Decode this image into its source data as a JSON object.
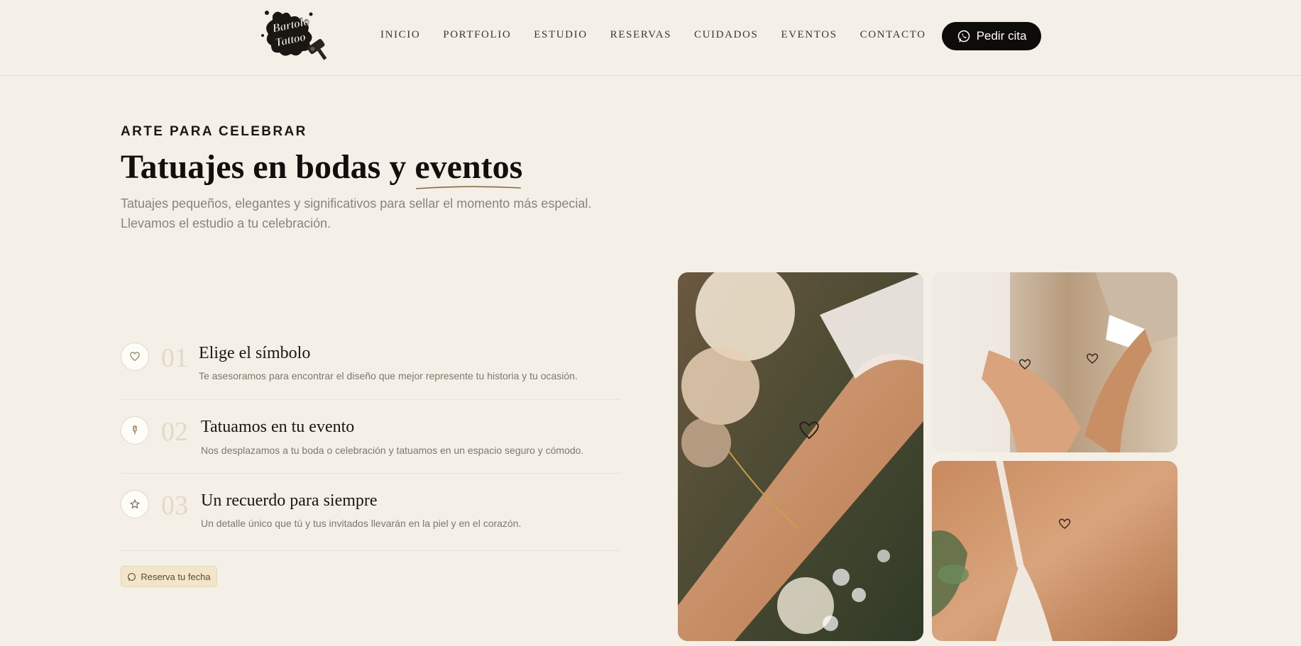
{
  "header": {
    "logo_text": "Bartolo Tattoo",
    "nav": [
      {
        "label": "INICIO"
      },
      {
        "label": "PORTFOLIO"
      },
      {
        "label": "ESTUDIO"
      },
      {
        "label": "RESERVAS"
      },
      {
        "label": "CUIDADOS"
      },
      {
        "label": "EVENTOS"
      },
      {
        "label": "CONTACTO"
      }
    ],
    "cta_label": "Pedir cita",
    "cta_icon": "whatsapp-icon"
  },
  "hero": {
    "eyebrow": "ARTE PARA CELEBRAR",
    "title_start": "Tatuajes en bodas y ",
    "title_emphasis": "eventos",
    "subtitle_line1": "Tatuajes pequeños, elegantes y significativos para sellar el momento más especial.",
    "subtitle_line2": "Llevamos el estudio a tu celebración."
  },
  "steps": [
    {
      "icon": "heart-icon",
      "number": "01",
      "title": "Elige el símbolo",
      "description": "Te asesoramos para encontrar el diseño que mejor represente tu historia y tu ocasión."
    },
    {
      "icon": "tattoo-machine-icon",
      "number": "02",
      "title": "Tatuamos en tu evento",
      "description": "Nos desplazamos a tu boda o celebración y tatuamos en un espacio seguro y cómodo."
    },
    {
      "icon": "star-icon",
      "number": "03",
      "title": "Un recuerdo para siempre",
      "description": "Un detalle único que tú y tus invitados llevarán en la piel y en el corazón."
    }
  ],
  "book_button": {
    "label": "Reserva tu fecha",
    "icon": "whatsapp-icon"
  },
  "gallery": [
    {
      "description": "wrist-heart-tattoo-photo"
    },
    {
      "description": "couple-hands-heart-tattoos-photo"
    },
    {
      "description": "collarbone-heart-tattoo-photo"
    }
  ],
  "colors": {
    "background": "#f4f0e8",
    "cta_background": "#0d0c0b",
    "accent_gold": "#8e6a3a",
    "button_soft": "#f3e5c9"
  }
}
